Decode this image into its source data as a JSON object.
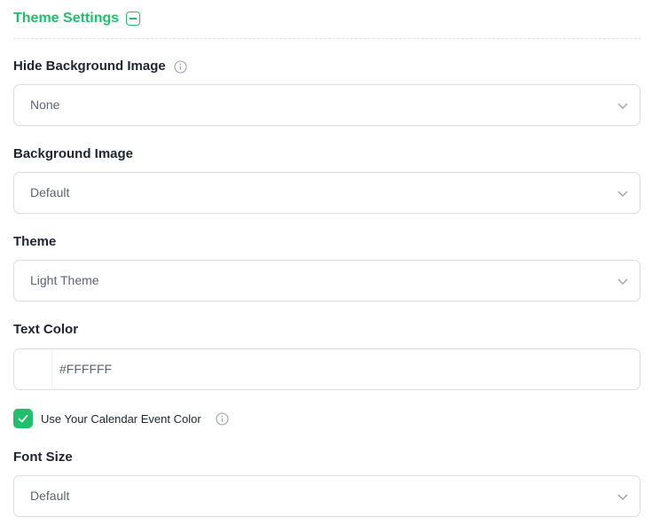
{
  "section": {
    "title": "Theme Settings"
  },
  "fields": {
    "hide_background": {
      "label": "Hide Background Image",
      "value": "None"
    },
    "background_image": {
      "label": "Background Image",
      "value": "Default"
    },
    "theme": {
      "label": "Theme",
      "value": "Light Theme"
    },
    "text_color": {
      "label": "Text Color",
      "value": "#FFFFFF"
    },
    "calendar_color": {
      "label": "Use Your Calendar Event Color",
      "checked": true
    },
    "font_size": {
      "label": "Font Size",
      "value": "Default"
    }
  },
  "colors": {
    "accent": "#20bf6b",
    "border": "#dadee3",
    "text": "#1e2430",
    "muted": "#5d6470"
  },
  "icons": [
    "collapse-icon",
    "info-icon",
    "chevron-down-icon",
    "check-icon"
  ]
}
